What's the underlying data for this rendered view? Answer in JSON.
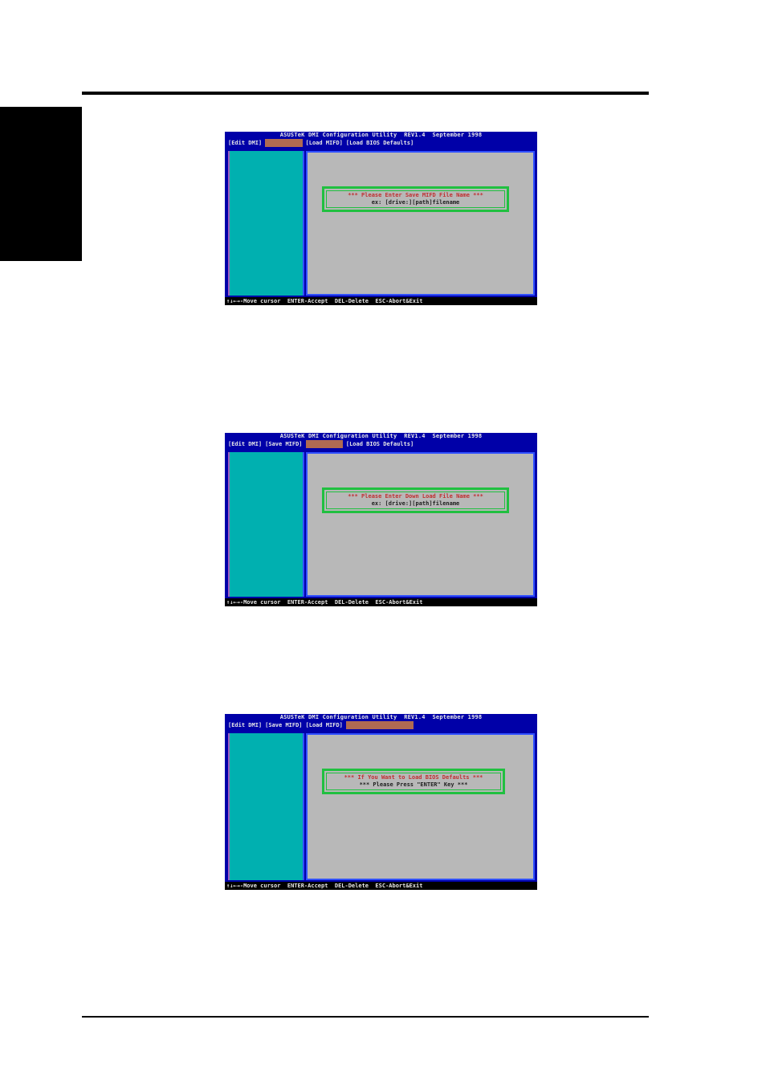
{
  "screens": [
    {
      "title": "ASUSTeK DMI Configuration Utility  REV1.4  September 1998",
      "menu": [
        "[Edit DMI]",
        "[Save MIFD]",
        "[Load MIFD]",
        "[Load BIOS Defaults]"
      ],
      "active_index": 1,
      "dialog_line1": "*** Please Enter Save MIFD File Name ***",
      "dialog_line2": "ex: [drive:][path]filename",
      "status": "↑↓←→-Move cursor  ENTER-Accept  DEL-Delete  ESC-Abort&Exit"
    },
    {
      "title": "ASUSTeK DMI Configuration Utility  REV1.4  September 1998",
      "menu": [
        "[Edit DMI]",
        "[Save MIFD]",
        "[Load MIFD]",
        "[Load BIOS Defaults]"
      ],
      "active_index": 2,
      "dialog_line1": "*** Please Enter Down Load File Name ***",
      "dialog_line2": "ex: [drive:][path]filename",
      "status": "↑↓←→-Move cursor  ENTER-Accept  DEL-Delete  ESC-Abort&Exit"
    },
    {
      "title": "ASUSTeK DMI Configuration Utility  REV1.4  September 1998",
      "menu": [
        "[Edit DMI]",
        "[Save MIFD]",
        "[Load MIFD]",
        "[Load BIOS Defaults]"
      ],
      "active_index": 3,
      "dialog_line1": "*** If You Want to Load BIOS Defaults ***",
      "dialog_line2": "*** Please Press \"ENTER\" Key ***",
      "status": "↑↓←→-Move cursor  ENTER-Accept  DEL-Delete  ESC-Abort&Exit"
    }
  ],
  "colors": {
    "screen_bg": "#0000a8",
    "left_panel": "#00b0b0",
    "right_panel": "#b8b8b8",
    "dialog_border": "#20c040",
    "highlight": "#b06a52",
    "dialog_text_red": "#c03030"
  }
}
